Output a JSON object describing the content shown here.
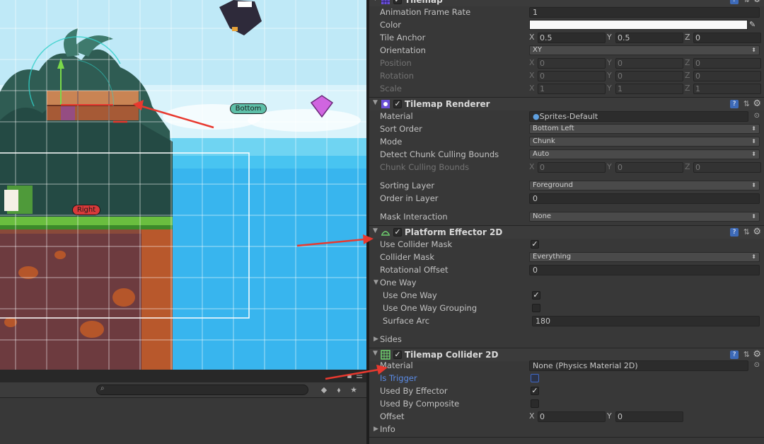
{
  "scene": {
    "labels": {
      "bottom": "Bottom",
      "right": "Right"
    }
  },
  "lower_toolbar": {
    "search_placeholder": ""
  },
  "inspector": {
    "tilemap": {
      "title": "Tilemap",
      "animation_frame_rate": {
        "label": "Animation Frame Rate",
        "value": "1"
      },
      "color": {
        "label": "Color",
        "value": "#FFFFFF"
      },
      "tile_anchor": {
        "label": "Tile Anchor",
        "x": "0.5",
        "y": "0.5",
        "z": "0"
      },
      "orientation": {
        "label": "Orientation",
        "value": "XY"
      },
      "position": {
        "label": "Position",
        "x": "0",
        "y": "0",
        "z": "0"
      },
      "rotation": {
        "label": "Rotation",
        "x": "0",
        "y": "0",
        "z": "0"
      },
      "scale": {
        "label": "Scale",
        "x": "1",
        "y": "1",
        "z": "1"
      }
    },
    "tilemap_renderer": {
      "title": "Tilemap Renderer",
      "material": {
        "label": "Material",
        "value": "Sprites-Default"
      },
      "sort_order": {
        "label": "Sort Order",
        "value": "Bottom Left"
      },
      "mode": {
        "label": "Mode",
        "value": "Chunk"
      },
      "detect_chunk_culling_bounds": {
        "label": "Detect Chunk Culling Bounds",
        "value": "Auto"
      },
      "chunk_culling_bounds": {
        "label": "Chunk Culling Bounds",
        "x": "0",
        "y": "0",
        "z": "0"
      },
      "sorting_layer": {
        "label": "Sorting Layer",
        "value": "Foreground"
      },
      "order_in_layer": {
        "label": "Order in Layer",
        "value": "0"
      },
      "mask_interaction": {
        "label": "Mask Interaction",
        "value": "None"
      }
    },
    "platform_effector": {
      "title": "Platform Effector 2D",
      "use_collider_mask": {
        "label": "Use Collider Mask",
        "checked": true
      },
      "collider_mask": {
        "label": "Collider Mask",
        "value": "Everything"
      },
      "rotational_offset": {
        "label": "Rotational Offset",
        "value": "0"
      },
      "one_way": {
        "label": "One Way"
      },
      "use_one_way": {
        "label": "Use One Way",
        "checked": true
      },
      "use_one_way_grouping": {
        "label": "Use One Way Grouping",
        "checked": false
      },
      "surface_arc": {
        "label": "Surface Arc",
        "value": "180"
      },
      "sides": {
        "label": "Sides"
      }
    },
    "tilemap_collider": {
      "title": "Tilemap Collider 2D",
      "material": {
        "label": "Material",
        "value": "None (Physics Material 2D)"
      },
      "is_trigger": {
        "label": "Is Trigger",
        "checked": false
      },
      "used_by_effector": {
        "label": "Used By Effector",
        "checked": true
      },
      "used_by_composite": {
        "label": "Used By Composite",
        "checked": false
      },
      "offset": {
        "label": "Offset",
        "x": "0",
        "y": "0"
      },
      "info": {
        "label": "Info"
      }
    },
    "axis_labels": {
      "x": "X",
      "y": "Y",
      "z": "Z"
    }
  },
  "colors": {
    "annotation_arrow": "#e8392f",
    "help_icon": "#3d6ab8"
  }
}
